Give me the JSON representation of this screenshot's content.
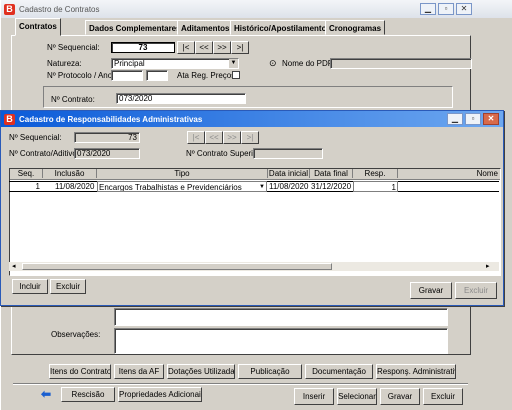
{
  "main_window": {
    "title": "Cadastro de Contratos",
    "tabs": [
      "Contratos",
      "Dados Complementares",
      "Aditamentos",
      "Histórico/Apostilamento",
      "Cronogramas"
    ],
    "fields": {
      "seq_label": "Nº Sequencial:",
      "seq_value": "73",
      "natureza_label": "Natureza:",
      "natureza_value": "Principal",
      "protocolo_label": "Nº Protocolo / Ano:",
      "ata_label": "Ata Reg. Preços",
      "pdf_label": "Nome do PDF:",
      "contrato_label": "Nº Contrato:",
      "contrato_value": "073/2020",
      "observacoes_label": "Observações:"
    },
    "nav_buttons": {
      "first": "|<",
      "prev": "<<",
      "next": ">>",
      "last": ">|"
    },
    "bottom_buttons": [
      "Itens do Contrato",
      "Itens da AF",
      "Dotações Utilizadas",
      "Publicação",
      "Documentação",
      "Responş. Administrativa"
    ],
    "action_buttons": {
      "rescisao": "Rescisão",
      "propriedades": "Propriedades Adicionais",
      "inserir": "Inserir",
      "selecionar": "Selecionar",
      "gravar": "Gravar",
      "excluir": "Excluir"
    }
  },
  "dialog": {
    "title": "Cadastro de Responsabilidades Administrativas",
    "seq_label": "Nº Sequencial:",
    "seq_value": "73",
    "contrato_label": "Nº Contrato/Aditivo:",
    "contrato_value": "073/2020",
    "superior_label": "Nº Contrato Superior:",
    "nav_buttons": {
      "first": "|<",
      "prev": "<<",
      "next": ">>",
      "last": ">|"
    },
    "columns": [
      "Seq.",
      "Inclusão",
      "Tipo",
      "Data inicial",
      "Data final",
      "Resp.",
      "Nome"
    ],
    "rows": [
      {
        "seq": "1",
        "inclusao": "11/08/2020",
        "tipo": "Encargos Trabalhistas e Previdenciários",
        "data_inicial": "11/08/2020",
        "data_final": "31/12/2020",
        "resp": "1",
        "nome": ""
      }
    ],
    "buttons": {
      "incluir": "Incluir",
      "excluir": "Excluir",
      "gravar": "Gravar",
      "excluir2": "Excluir"
    }
  },
  "colors": {
    "dialog_title_start": "#0a5ad8",
    "dialog_title_end": "#6ea8f0",
    "main_title": "#e8ecf2",
    "logo": "#e03020"
  }
}
